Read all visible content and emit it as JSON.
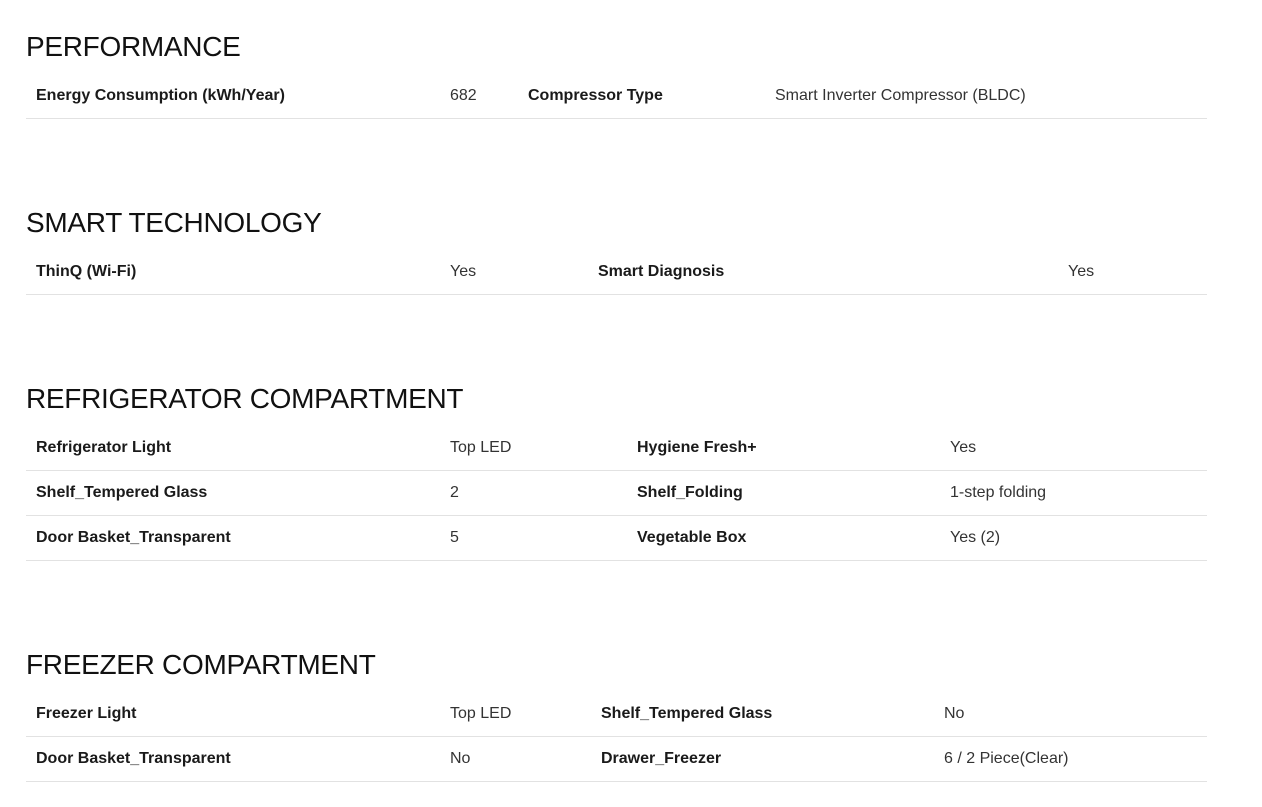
{
  "sections": [
    {
      "title": "PERFORMANCE",
      "rows": [
        [
          "Energy Consumption (kWh/Year)",
          "682",
          "Compressor Type",
          "Smart Inverter Compressor (BLDC)"
        ]
      ]
    },
    {
      "title": "SMART TECHNOLOGY",
      "rows": [
        [
          "ThinQ (Wi-Fi)",
          "Yes",
          "Smart Diagnosis",
          "Yes"
        ]
      ]
    },
    {
      "title": "REFRIGERATOR COMPARTMENT",
      "rows": [
        [
          "Refrigerator Light",
          "Top LED",
          "Hygiene Fresh+",
          "Yes"
        ],
        [
          "Shelf_Tempered Glass",
          "2",
          "Shelf_Folding",
          "1-step folding"
        ],
        [
          "Door Basket_Transparent",
          "5",
          "Vegetable Box",
          "Yes (2)"
        ]
      ]
    },
    {
      "title": "FREEZER COMPARTMENT",
      "rows": [
        [
          "Freezer Light",
          "Top LED",
          "Shelf_Tempered Glass",
          "No"
        ],
        [
          "Door Basket_Transparent",
          "No",
          "Drawer_Freezer",
          "6 / 2 Piece(Clear)"
        ]
      ]
    }
  ]
}
